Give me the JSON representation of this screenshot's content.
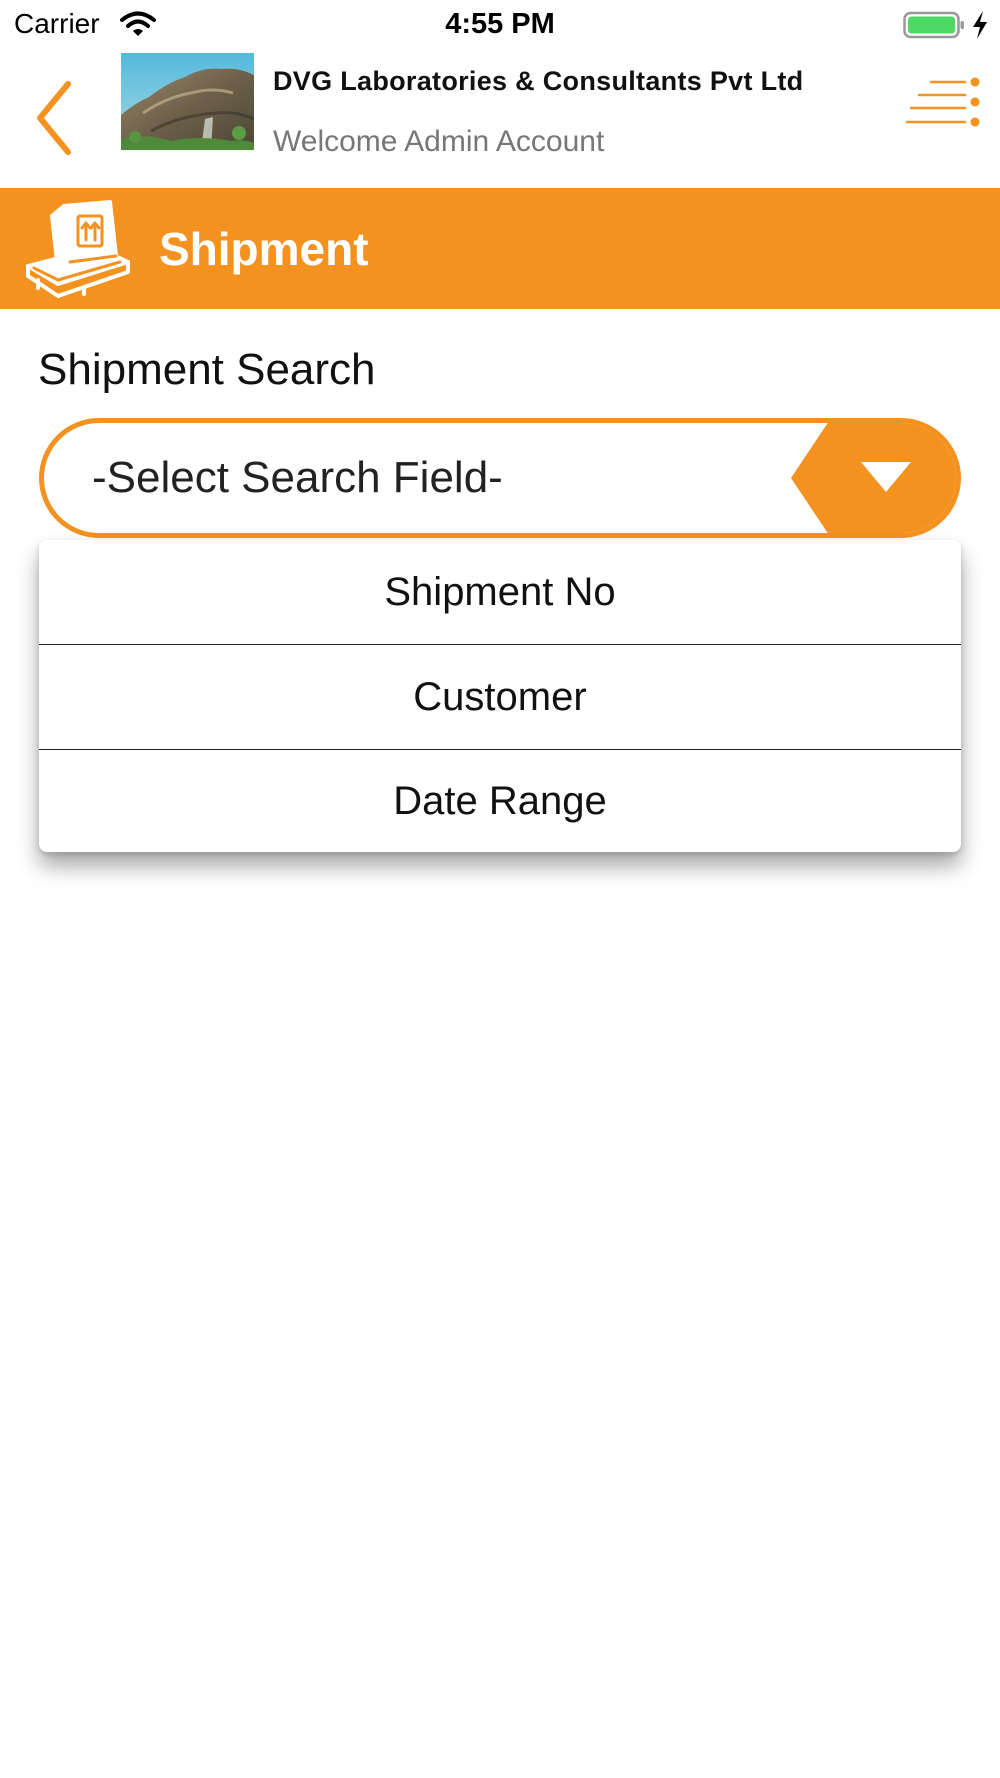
{
  "status_bar": {
    "carrier": "Carrier",
    "time": "4:55 PM",
    "battery_color": "#4cd964"
  },
  "header": {
    "company_name": "DVG Laboratories & Consultants Pvt Ltd",
    "welcome": "Welcome Admin Account",
    "accent_color": "#f49220"
  },
  "section": {
    "title": "Shipment",
    "icon": "box-on-pallet-icon",
    "background": "#f49220"
  },
  "search": {
    "label": "Shipment Search",
    "selected_value": "-Select Search Field-",
    "options": [
      "Shipment No",
      "Customer",
      "Date Range"
    ]
  }
}
